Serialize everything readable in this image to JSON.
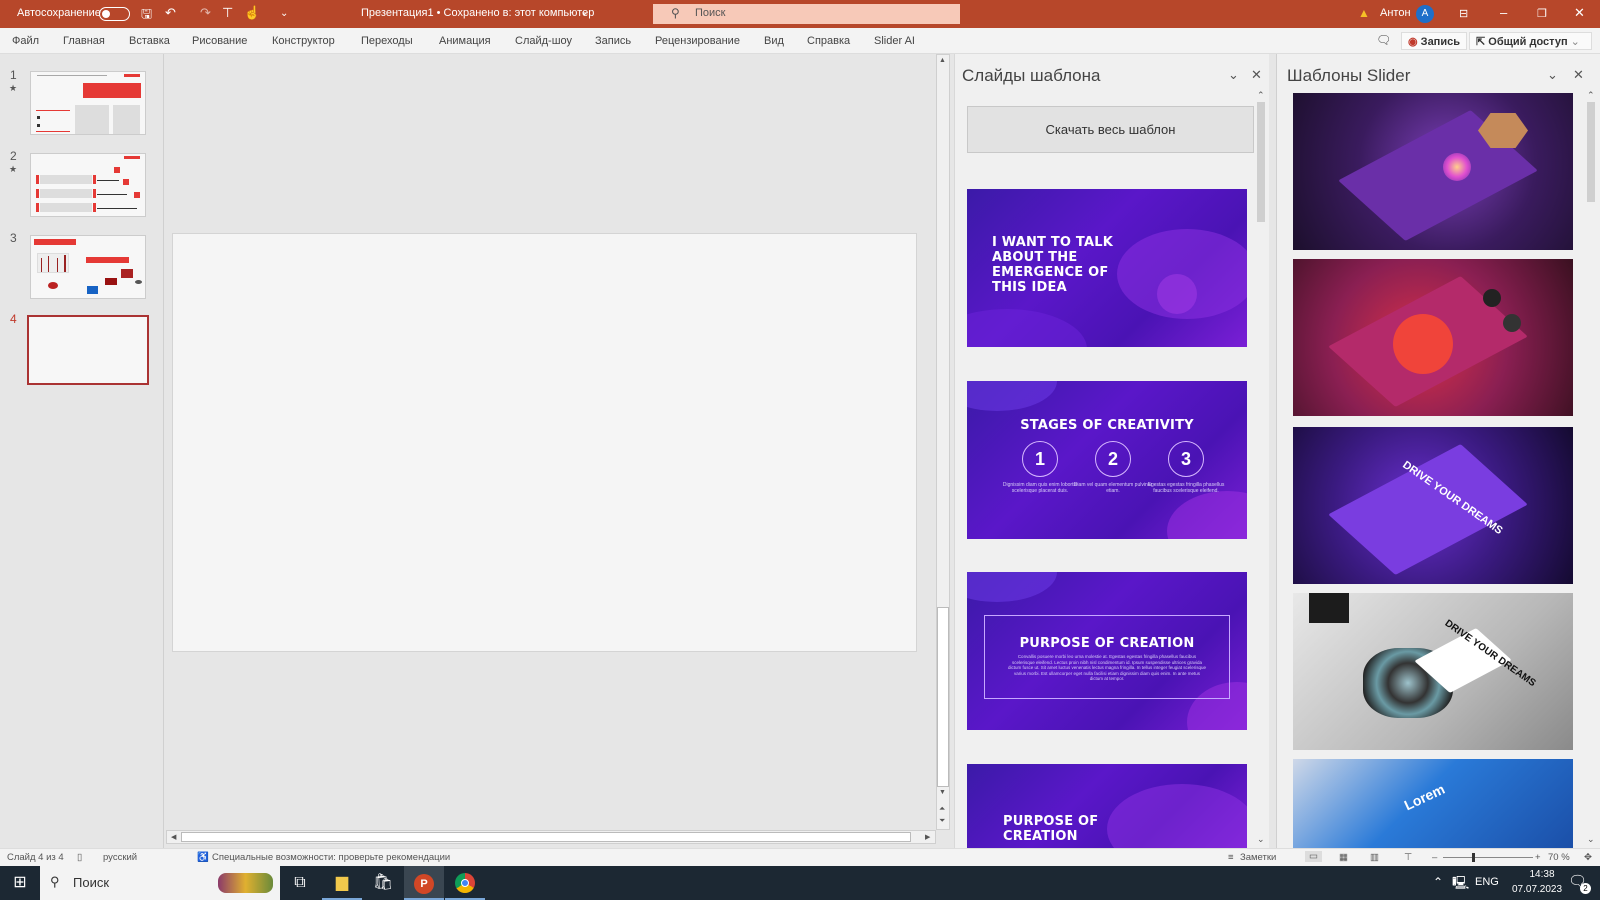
{
  "titlebar": {
    "autosave_label": "Автосохранение",
    "doc_title": "Презентация1 • Сохранено в: этот компьютер",
    "search_placeholder": "Поиск",
    "user_name": "Антон",
    "avatar_initial": "A",
    "accent": "#b7472a"
  },
  "menu": {
    "items": [
      "Файл",
      "Главная",
      "Вставка",
      "Рисование",
      "Конструктор",
      "Переходы",
      "Анимация",
      "Слайд-шоу",
      "Запись",
      "Рецензирование",
      "Вид",
      "Справка",
      "Slider AI"
    ],
    "record_label": "Запись",
    "share_label": "Общий доступ"
  },
  "thumbnails": {
    "items": [
      {
        "number": "1",
        "starred": true
      },
      {
        "number": "2",
        "starred": true
      },
      {
        "number": "3",
        "starred": false
      },
      {
        "number": "4",
        "starred": false,
        "selected": true
      }
    ]
  },
  "panel_template": {
    "title": "Слайды шаблона",
    "download_label": "Скачать весь шаблон",
    "slides": [
      {
        "title": "I WANT TO TALK ABOUT THE EMERGENCE OF THIS IDEA"
      },
      {
        "title": "STAGES OF CREATIVITY",
        "steps": [
          {
            "n": "1",
            "text": "Dignissim diam quis enim lobortis scelerisque placerat duis."
          },
          {
            "n": "2",
            "text": "Diam vel quam elementum pulvinar etiam."
          },
          {
            "n": "3",
            "text": "Egestas egestas fringilla phasellus faucibus scelerisque eleifend."
          }
        ]
      },
      {
        "title": "PURPOSE OF CREATION",
        "body": "Convallis posuere morbi leo urna molestie at. Egestas egestas fringilla phasellus faucibus scelerisque eleifend. Lectus proin nibh nisl condimentum id. Ipsum suspendisse ultrices gravida dictum fusce ut. Sit amet luctus venenatis lectus magna fringilla. In tellus integer feugiat scelerisque varius morbi. Est ullamcorper eget nulla facilisi etiam dignissim diam quis enim. In ante metus dictum at tempor."
      },
      {
        "title": "PURPOSE OF CREATION"
      }
    ]
  },
  "panel_slider": {
    "title": "Шаблоны Slider",
    "images": [
      {
        "text": ""
      },
      {
        "text": ""
      },
      {
        "text": "DRIVE YOUR DREAMS"
      },
      {
        "text": "DRIVE YOUR DREAMS"
      },
      {
        "text": "Lorem"
      }
    ]
  },
  "status": {
    "slide_info": "Слайд 4 из 4",
    "language": "русский",
    "accessibility": "Специальные возможности: проверьте рекомендации",
    "notes_label": "Заметки",
    "zoom": "70 %",
    "zoom_percent": 70
  },
  "taskbar": {
    "search_placeholder": "Поиск",
    "language": "ENG",
    "time": "14:38",
    "date": "07.07.2023",
    "notifications": "2"
  }
}
